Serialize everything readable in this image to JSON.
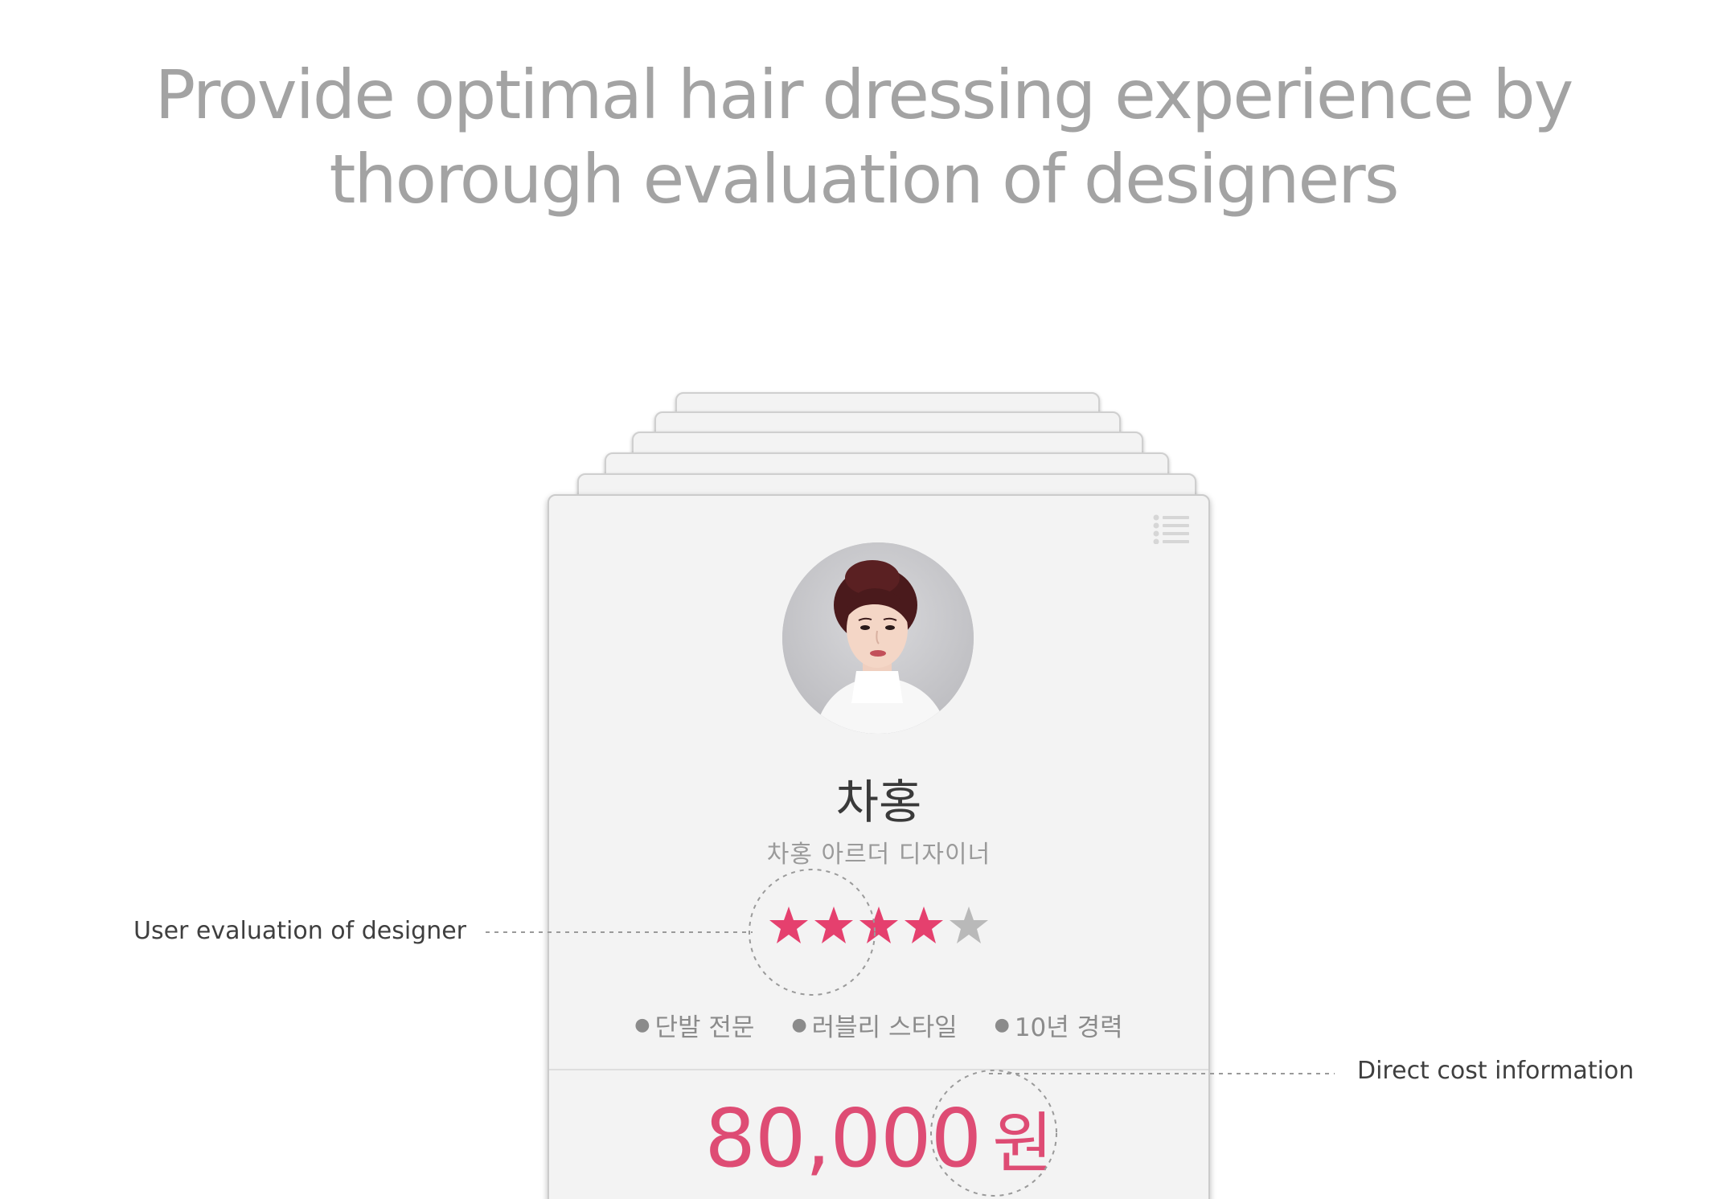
{
  "headline": {
    "line1": "Provide optimal hair dressing experience by",
    "line2": "thorough evaluation of designers"
  },
  "designer_card": {
    "menu_icon": "list-icon",
    "avatar_icon": "designer-portrait",
    "name": "차홍",
    "title": "차홍 아르더 디자이너",
    "rating": {
      "value": 4,
      "max": 5,
      "filled_color": "#e5406e",
      "empty_color": "#b9b9b9"
    },
    "tags": [
      "단발 전문",
      "러블리 스타일",
      "10년 경력"
    ],
    "price": {
      "amount": "80,000",
      "unit": "원",
      "color": "#de4c74"
    }
  },
  "callouts": {
    "evaluation_label": "User evaluation of designer",
    "cost_label": "Direct cost information"
  }
}
